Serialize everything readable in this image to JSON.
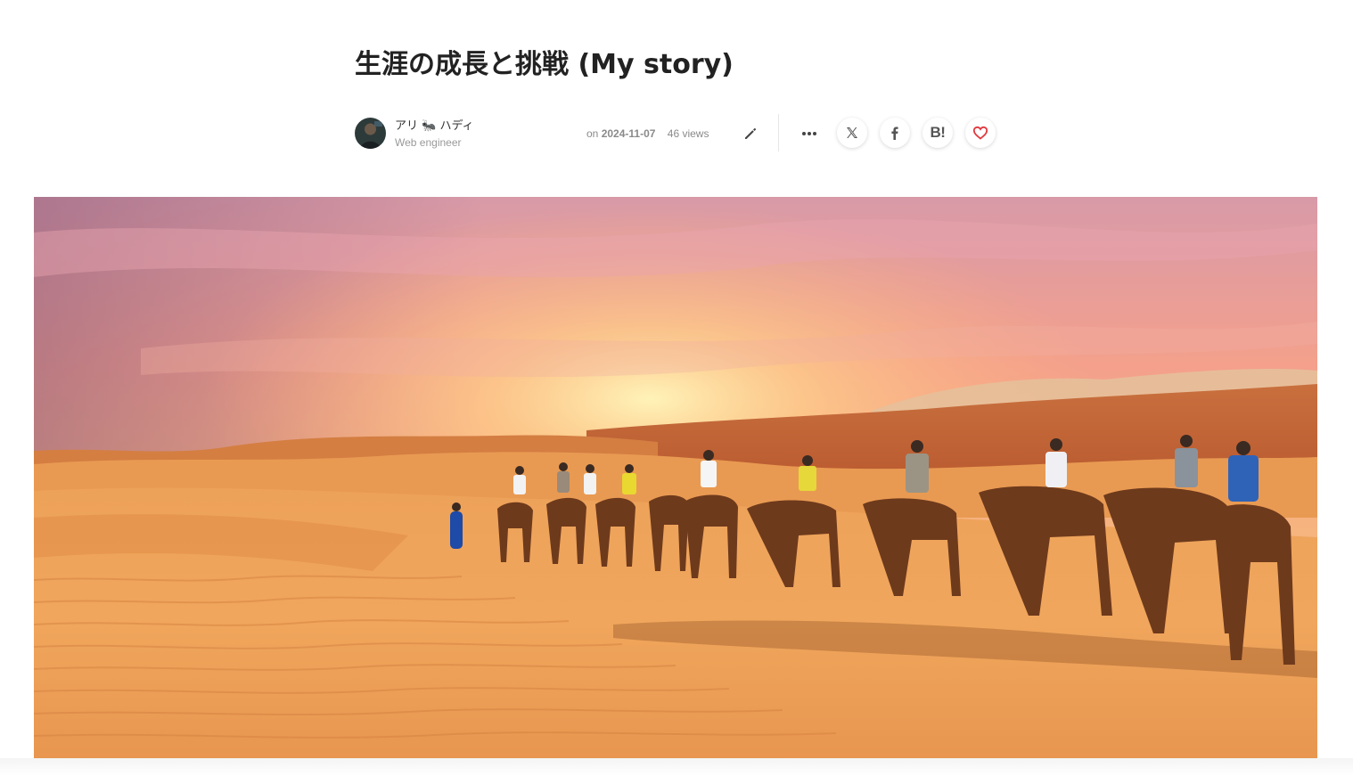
{
  "article": {
    "title": "生涯の成長と挑戦 (My story)"
  },
  "author": {
    "name": "アリ 🐜 ハディ",
    "role": "Web engineer"
  },
  "post": {
    "date_prefix": "on",
    "date": "2024-11-07",
    "views": "46 views"
  },
  "actions": {
    "edit_icon": "pencil-icon",
    "more_icon": "more-horizontal-icon",
    "share": [
      {
        "name": "x",
        "glyph": "𝕏"
      },
      {
        "name": "facebook",
        "glyph": "f"
      },
      {
        "name": "hatena-bookmark",
        "glyph": "B!"
      }
    ],
    "like_icon": "heart-icon"
  },
  "hero_image": {
    "subject": "camel caravan crossing desert dunes at sunset"
  },
  "colors": {
    "title": "#222222",
    "meta_text": "#8a8a8a",
    "like_red": "#e0393e"
  }
}
